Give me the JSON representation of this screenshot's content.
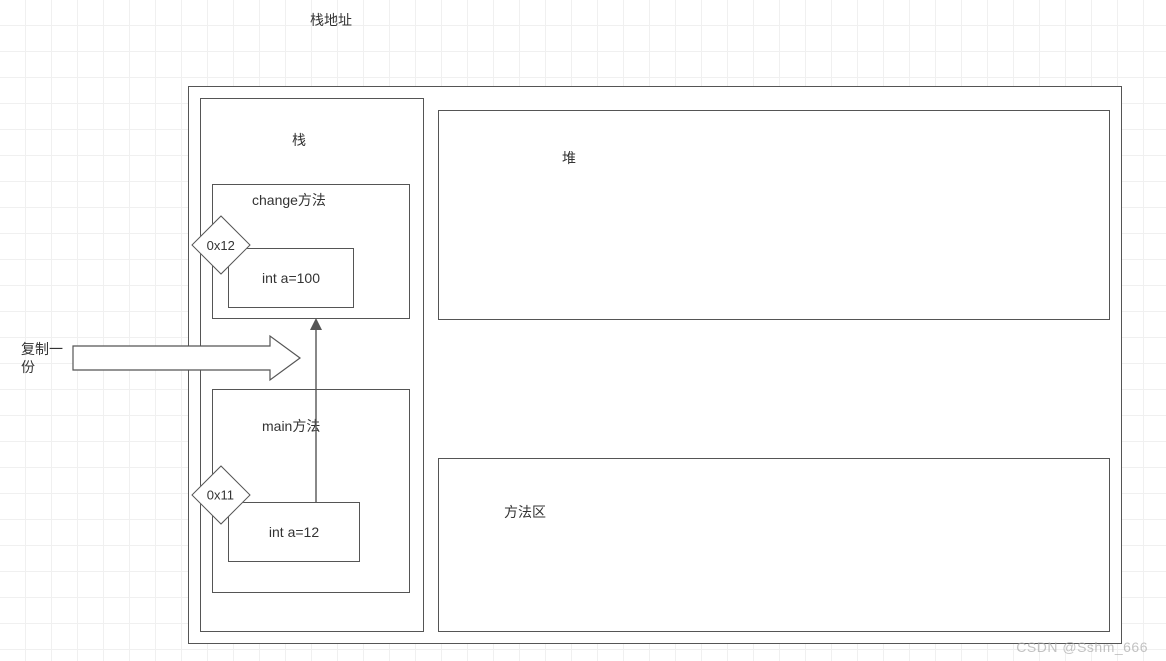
{
  "title": "栈地址",
  "stack": {
    "label": "栈",
    "frames": [
      {
        "name": "change方法",
        "addr": "0x12",
        "var": "int a=100"
      },
      {
        "name": "main方法",
        "addr": "0x11",
        "var": "int a=12"
      }
    ]
  },
  "heap": {
    "label": "堆"
  },
  "methodArea": {
    "label": "方法区"
  },
  "copyNote": "复制一份",
  "watermark": "CSDN @Sshm_666"
}
